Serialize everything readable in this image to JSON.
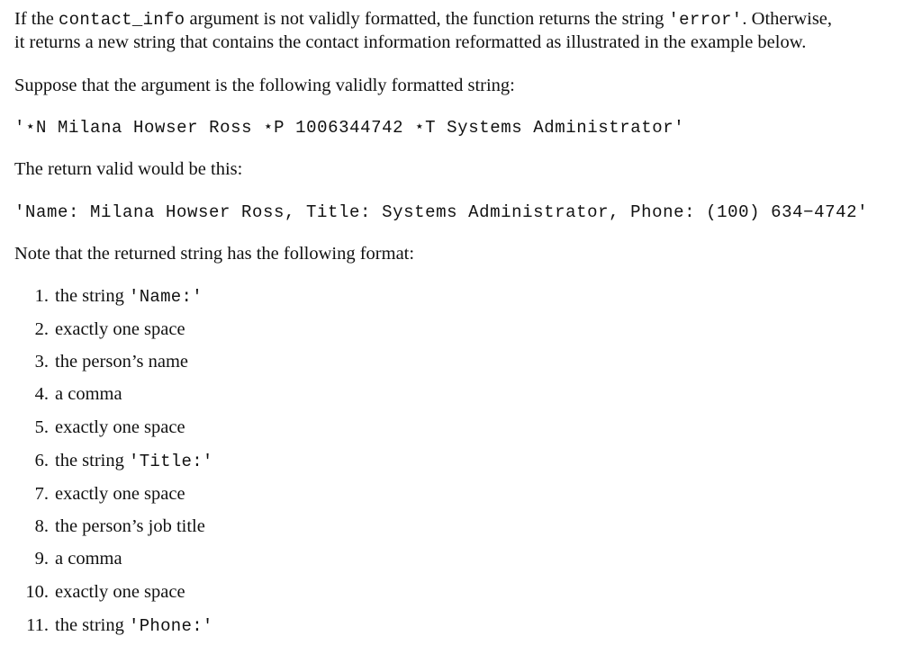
{
  "intro": {
    "line1_pre": "If the ",
    "line1_code": "contact_info",
    "line1_mid": " argument is not validly formatted, the function returns the string ",
    "line1_code2": "'error'",
    "line1_post": ". Otherwise,",
    "line2": "it returns a new string that contains the contact information reformatted as illustrated in the example below."
  },
  "suppose_text": "Suppose that the argument is the following validly formatted string:",
  "example_input": "'⋆N Milana Howser Ross ⋆P 1006344742 ⋆T Systems Administrator'",
  "return_text": "The return valid would be this:",
  "example_output": "'Name: Milana Howser Ross, Title: Systems Administrator, Phone: (100) 634−4742'",
  "note_text": "Note that the returned string has the following format:",
  "format_list": [
    {
      "num": "1.",
      "text": "the string ",
      "code": "'Name:'"
    },
    {
      "num": "2.",
      "text": "exactly one space",
      "code": ""
    },
    {
      "num": "3.",
      "text": "the person’s name",
      "code": ""
    },
    {
      "num": "4.",
      "text": "a comma",
      "code": ""
    },
    {
      "num": "5.",
      "text": "exactly one space",
      "code": ""
    },
    {
      "num": "6.",
      "text": "the string ",
      "code": "'Title:'"
    },
    {
      "num": "7.",
      "text": "exactly one space",
      "code": ""
    },
    {
      "num": "8.",
      "text": "the person’s job title",
      "code": ""
    },
    {
      "num": "9.",
      "text": "a comma",
      "code": ""
    },
    {
      "num": "10.",
      "text": "exactly one space",
      "code": ""
    },
    {
      "num": "11.",
      "text": "the string ",
      "code": "'Phone:'"
    }
  ]
}
